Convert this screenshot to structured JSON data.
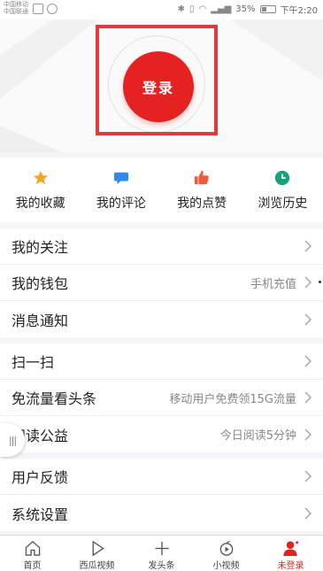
{
  "status_bar": {
    "carrier_line1": "中国移动",
    "carrier_line2": "中国联通",
    "battery": "35%",
    "time": "下午2:20"
  },
  "header": {
    "login_label": "登录"
  },
  "quick_actions": [
    {
      "label": "我的收藏",
      "icon": "star-icon",
      "color": "#f5a623"
    },
    {
      "label": "我的评论",
      "icon": "comment-icon",
      "color": "#2d8cf0"
    },
    {
      "label": "我的点赞",
      "icon": "thumbs-up-icon",
      "color": "#f25b3a"
    },
    {
      "label": "浏览历史",
      "icon": "clock-icon",
      "color": "#13a37f"
    }
  ],
  "menu": {
    "group1": [
      {
        "label": "我的关注",
        "extra": ""
      },
      {
        "label": "我的钱包",
        "extra": "手机充值"
      },
      {
        "label": "消息通知",
        "extra": ""
      }
    ],
    "group2": [
      {
        "label": "扫一扫",
        "extra": ""
      },
      {
        "label": "免流量看头条",
        "extra": "移动用户免费领15G流量"
      },
      {
        "label": "阅读公益",
        "extra": "今日阅读5分钟"
      }
    ],
    "group3": [
      {
        "label": "用户反馈",
        "extra": ""
      },
      {
        "label": "系统设置",
        "extra": ""
      }
    ]
  },
  "bottom_nav": [
    {
      "label": "首页",
      "icon": "home-icon"
    },
    {
      "label": "西瓜视频",
      "icon": "play-icon"
    },
    {
      "label": "发头条",
      "icon": "plus-icon"
    },
    {
      "label": "小视频",
      "icon": "short-video-icon"
    },
    {
      "label": "未登录",
      "icon": "user-icon",
      "active": true
    }
  ],
  "colors": {
    "accent": "#e52222",
    "highlight_frame": "#e23a3a"
  }
}
